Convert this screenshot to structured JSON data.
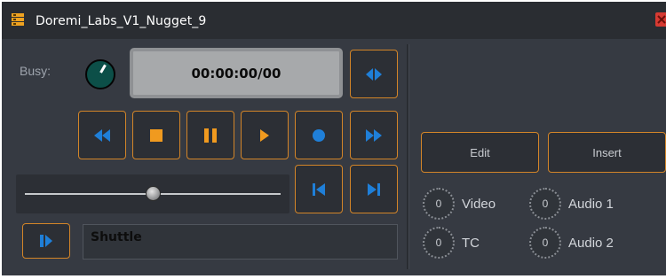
{
  "window": {
    "title": "Doremi_Labs_V1_Nugget_9",
    "app_icon": "server-stack-icon",
    "close_icon": "close-x-icon"
  },
  "colors": {
    "panel": "#363a42",
    "button_border": "#d38528",
    "icon_blue": "#1f7fd8",
    "icon_orange": "#f09a1f",
    "busy_knob": "#0c4f48",
    "close_red": "#d63a32"
  },
  "status": {
    "busy_label": "Busy:"
  },
  "timecode": {
    "value": "00:00:00/00"
  },
  "transport": {
    "mode_icon": "split-arrows-icon",
    "buttons": [
      {
        "icon": "rewind-icon"
      },
      {
        "icon": "stop-icon"
      },
      {
        "icon": "pause-icon"
      },
      {
        "icon": "play-icon"
      },
      {
        "icon": "record-icon"
      },
      {
        "icon": "fast-forward-icon"
      }
    ],
    "skip_start_icon": "skip-to-start-icon",
    "skip_end_icon": "skip-to-end-icon",
    "slider_fraction": 0.5
  },
  "shuttle": {
    "button_icon": "step-forward-icon",
    "label": "Shuttle"
  },
  "actions": {
    "edit_label": "Edit",
    "insert_label": "Insert"
  },
  "indicators": [
    {
      "value": "0",
      "label": "Video"
    },
    {
      "value": "0",
      "label": "Audio 1"
    },
    {
      "value": "0",
      "label": "TC"
    },
    {
      "value": "0",
      "label": "Audio 2"
    }
  ]
}
